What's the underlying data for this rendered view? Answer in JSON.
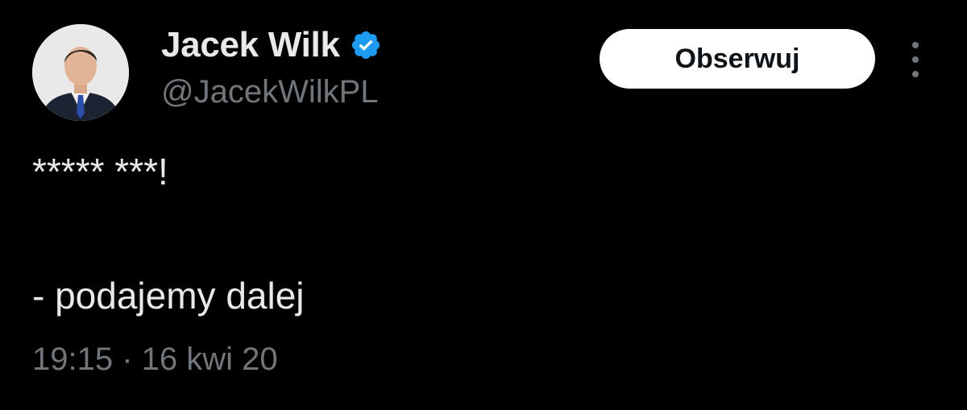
{
  "author": {
    "display_name": "Jacek Wilk",
    "handle": "@JacekWilkPL",
    "verified_icon": "verified-badge-icon",
    "verified_color": "#1d9bf0"
  },
  "follow_button": {
    "label": "Obserwuj"
  },
  "more_menu": {
    "icon": "more-vertical-icon"
  },
  "tweet": {
    "lines": [
      "***** ***!",
      "- podajemy dalej"
    ],
    "timestamp": "19:15 · 16 kwi 20"
  },
  "colors": {
    "background": "#000000",
    "primary_text": "#e7e9ea",
    "secondary_text": "#71767b",
    "button_bg": "#ffffff",
    "button_text": "#0f1419"
  }
}
